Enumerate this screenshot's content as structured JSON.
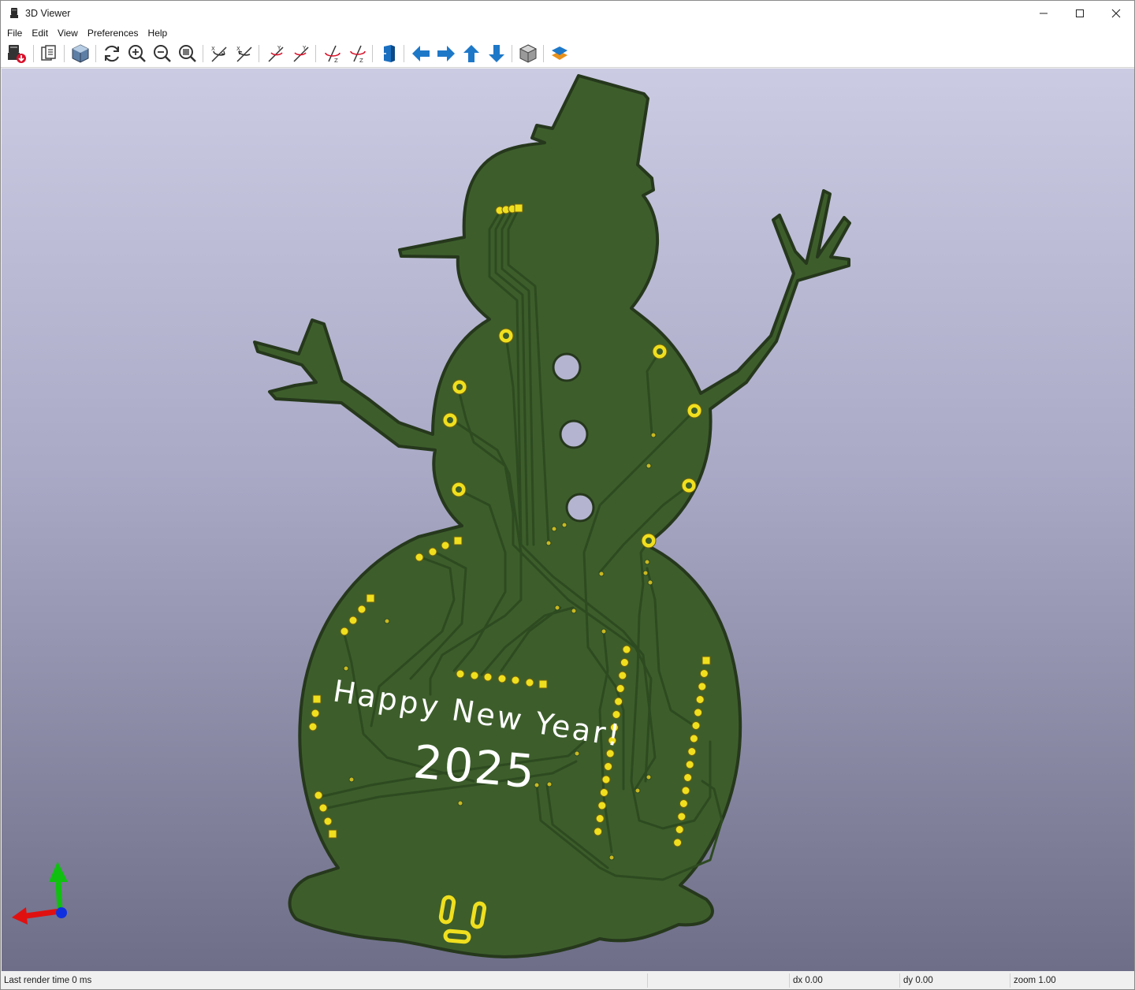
{
  "window": {
    "title": "3D Viewer",
    "controls": {
      "minimize": "minimize-icon",
      "maximize": "maximize-icon",
      "close": "close-icon"
    }
  },
  "menu": [
    "File",
    "Edit",
    "View",
    "Preferences",
    "Help"
  ],
  "toolbar": [
    {
      "name": "export-image-button",
      "icon": "export-image-icon"
    },
    {
      "name": "copy-to-clipboard-button",
      "icon": "clipboard-icon"
    },
    {
      "name": "render-mode-button",
      "icon": "raytrace-cube-icon"
    },
    {
      "name": "reload-board-button",
      "icon": "refresh-icon"
    },
    {
      "name": "zoom-in-button",
      "icon": "zoom-in-icon"
    },
    {
      "name": "zoom-out-button",
      "icon": "zoom-out-icon"
    },
    {
      "name": "zoom-fit-button",
      "icon": "zoom-fit-icon"
    },
    {
      "name": "rotate-x-cw-button",
      "icon": "rotate-x-cw-icon"
    },
    {
      "name": "rotate-x-ccw-button",
      "icon": "rotate-x-ccw-icon"
    },
    {
      "name": "rotate-y-cw-button",
      "icon": "rotate-y-cw-icon"
    },
    {
      "name": "rotate-y-ccw-button",
      "icon": "rotate-y-ccw-icon"
    },
    {
      "name": "rotate-z-cw-button",
      "icon": "rotate-z-cw-icon"
    },
    {
      "name": "rotate-z-ccw-button",
      "icon": "rotate-z-ccw-icon"
    },
    {
      "name": "flip-board-button",
      "icon": "flip-board-icon"
    },
    {
      "name": "move-left-button",
      "icon": "arrow-left-icon"
    },
    {
      "name": "move-right-button",
      "icon": "arrow-right-icon"
    },
    {
      "name": "move-up-button",
      "icon": "arrow-up-icon"
    },
    {
      "name": "move-down-button",
      "icon": "arrow-down-icon"
    },
    {
      "name": "orthographic-button",
      "icon": "ortho-cube-icon"
    },
    {
      "name": "layers-manager-button",
      "icon": "layers-icon"
    }
  ],
  "board": {
    "silkscreen_line1": "Happy New Year!",
    "silkscreen_line2": "2025",
    "soldermask_color": "#3d5e2b",
    "pad_color": "#f0df1e"
  },
  "axes": {
    "x_color": "#e01010",
    "y_color": "#10c010",
    "z_color": "#1030e0"
  },
  "status": {
    "render_time": "Last render time 0 ms",
    "dx": "dx 0.00",
    "dy": "dy 0.00",
    "zoom": "zoom 1.00"
  }
}
